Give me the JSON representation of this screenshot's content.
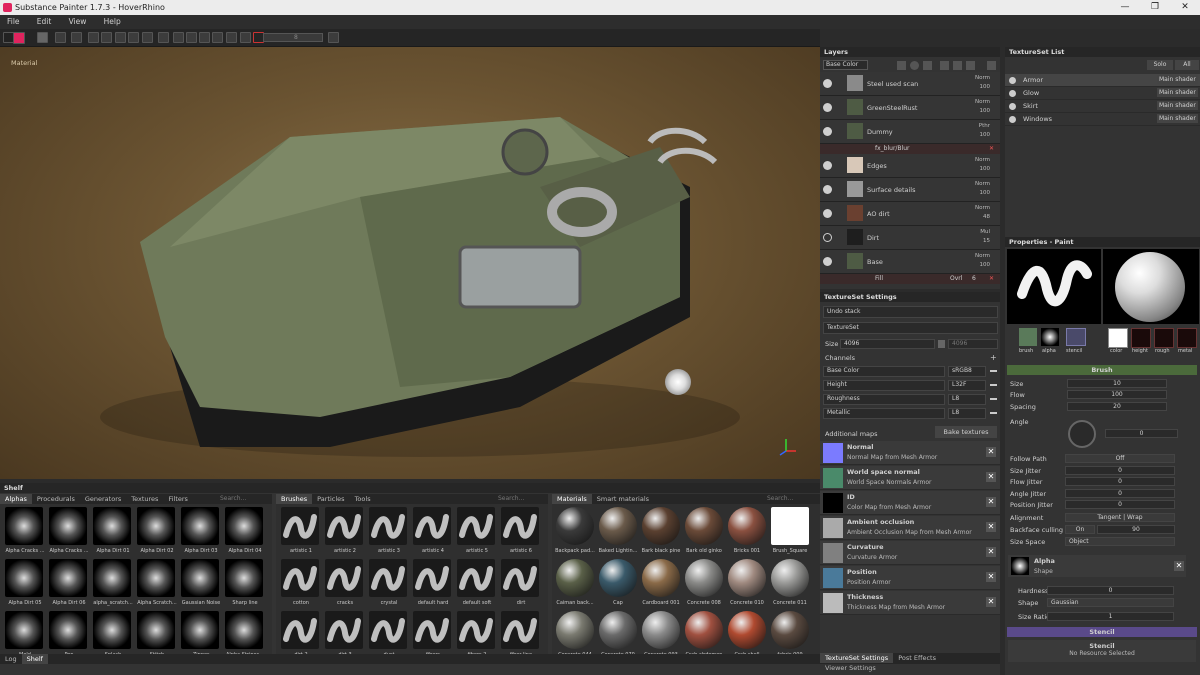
{
  "window": {
    "title": "Substance Painter 1.7.3 - HoverRhino",
    "minimize": "—",
    "maximize": "❐",
    "close": "✕"
  },
  "menu": [
    "File",
    "Edit",
    "View",
    "Help"
  ],
  "toolbar": {
    "size_value": "8"
  },
  "viewport": {
    "label": "Material"
  },
  "layers": {
    "title": "Layers",
    "channel": "Base Color",
    "rows": [
      {
        "name": "Steel used scan",
        "blend": "Norm",
        "opacity": "100",
        "color": "#8a8a8a",
        "visible": true
      },
      {
        "name": "GreenSteelRust",
        "blend": "Norm",
        "opacity": "100",
        "color": "#4e5b44",
        "visible": true
      },
      {
        "name": "Dummy",
        "blend": "Pthr",
        "opacity": "100",
        "color": "#4e5b44",
        "visible": true
      },
      {
        "name": "Edges",
        "blend": "Norm",
        "opacity": "100",
        "color": "#d8c8b8",
        "visible": true
      },
      {
        "name": "Surface details",
        "blend": "Norm",
        "opacity": "100",
        "color": "#999",
        "visible": true
      },
      {
        "name": "AO dirt",
        "blend": "Norm",
        "opacity": "48",
        "color": "#6a4030",
        "visible": true
      },
      {
        "name": "Dirt",
        "blend": "Mul",
        "opacity": "15",
        "color": "#1e1e1e",
        "visible": false
      },
      {
        "name": "Base",
        "blend": "Norm",
        "opacity": "100",
        "color": "#4e5b44",
        "visible": true
      }
    ],
    "effect_blur": "fx_blur/Blur",
    "effect_fill": "Fill",
    "fill_blend": "Ovrl",
    "fill_opacity": "6"
  },
  "textureset_list": {
    "title": "TextureSet List",
    "solo": "Solo",
    "all": "All",
    "items": [
      {
        "name": "Armor",
        "shader": "Main shader"
      },
      {
        "name": "Glow",
        "shader": "Main shader"
      },
      {
        "name": "Skirt",
        "shader": "Main shader"
      },
      {
        "name": "Windows",
        "shader": "Main shader"
      }
    ]
  },
  "textureset_settings": {
    "title": "TextureSet Settings",
    "undo_stack": "Undo stack",
    "textureset": "TextureSet",
    "size_label": "Size",
    "size_w": "4096",
    "size_h": "4096",
    "channels_label": "Channels",
    "channels": [
      {
        "name": "Base Color",
        "format": "sRGB8"
      },
      {
        "name": "Height",
        "format": "L32F"
      },
      {
        "name": "Roughness",
        "format": "L8"
      },
      {
        "name": "Metallic",
        "format": "L8"
      }
    ],
    "additional_maps": "Additional maps",
    "bake": "Bake textures",
    "maps": [
      {
        "title": "Normal",
        "sub": "Normal Map from Mesh Armor",
        "color": "#7b7bff"
      },
      {
        "title": "World space normal",
        "sub": "World Space Normals Armor",
        "color": "#4a8a6a"
      },
      {
        "title": "ID",
        "sub": "Color Map from Mesh Armor",
        "color": "#000000"
      },
      {
        "title": "Ambient occlusion",
        "sub": "Ambient Occlusion Map from Mesh Armor",
        "color": "#aaaaaa"
      },
      {
        "title": "Curvature",
        "sub": "Curvature Armor",
        "color": "#808080"
      },
      {
        "title": "Position",
        "sub": "Position Armor",
        "color": "#4a7a9a"
      },
      {
        "title": "Thickness",
        "sub": "Thickness Map from Mesh Armor",
        "color": "#bbbbbb"
      }
    ],
    "bottom_tabs": [
      "TextureSet Settings",
      "Post Effects",
      "Viewer Settings"
    ]
  },
  "properties": {
    "title": "Properties - Paint",
    "brush_tabs": [
      "brush",
      "alpha",
      "stencil"
    ],
    "mat_tabs": [
      "color",
      "height",
      "rough",
      "metal"
    ],
    "brush_section": "Brush",
    "size": {
      "label": "Size",
      "value": "10"
    },
    "flow": {
      "label": "Flow",
      "value": "100"
    },
    "spacing": {
      "label": "Spacing",
      "value": "20"
    },
    "angle": {
      "label": "Angle",
      "value": "0"
    },
    "follow_path": {
      "label": "Follow Path",
      "value": "Off"
    },
    "size_jitter": {
      "label": "Size Jitter",
      "value": "0"
    },
    "flow_jitter": {
      "label": "Flow Jitter",
      "value": "0"
    },
    "angle_jitter": {
      "label": "Angle Jitter",
      "value": "0"
    },
    "position_jitter": {
      "label": "Position Jitter",
      "value": "0"
    },
    "alignment": {
      "label": "Alignment",
      "value": "Tangent | Wrap"
    },
    "backface": {
      "label": "Backface culling",
      "on": "On",
      "value": "90"
    },
    "size_space": {
      "label": "Size Space",
      "value": "Object"
    },
    "alpha_section": "Alpha",
    "alpha_shape": "Shape",
    "hardness": {
      "label": "Hardness",
      "value": "0"
    },
    "shape": {
      "label": "Shape",
      "value": "Gaussian"
    },
    "size_ratio": {
      "label": "Size Ratio",
      "value": "1"
    },
    "stencil_section": "Stencil",
    "stencil_none": "No Resource Selected",
    "stencil_label": "Stencil"
  },
  "shelf": {
    "title": "Shelf",
    "alpha_tabs": [
      "Alphas",
      "Procedurals",
      "Generators",
      "Textures",
      "Filters"
    ],
    "search": "Search...",
    "alphas": [
      "Alpha Cracks ...",
      "Alpha Cracks ...",
      "Alpha Dirt 01",
      "Alpha Dirt 02",
      "Alpha Dirt 03",
      "Alpha Dirt 04",
      "Alpha Dirt 05",
      "Alpha Dirt 06",
      "alpha_scratch...",
      "Alpha Scratch...",
      "Gaussian Noise",
      "Sharp line",
      "Mold",
      "Pen",
      "Splash",
      "Stitch",
      "Zipper",
      "Alpha Stripes..."
    ],
    "brush_tabs": [
      "Brushes",
      "Particles",
      "Tools"
    ],
    "brushes": [
      "artistic 1",
      "artistic 2",
      "artistic 3",
      "artistic 4",
      "artistic 5",
      "artistic 6",
      "cotton",
      "cracks",
      "crystal",
      "default hard",
      "default soft",
      "dirt",
      "dirt 2",
      "dirt 3",
      "dust",
      "fibers",
      "fibers 2",
      "fiber line"
    ],
    "mat_tabs": [
      "Materials",
      "Smart materials"
    ],
    "materials": [
      {
        "n": "Backpack pad...",
        "c": "#3a3a3a"
      },
      {
        "n": "Baked Lightin...",
        "c": "#6a5a4a"
      },
      {
        "n": "Bark black pine",
        "c": "#5a4030"
      },
      {
        "n": "Bark old ginko",
        "c": "#6a4a38"
      },
      {
        "n": "Bricks 001",
        "c": "#8a5040"
      },
      {
        "n": "Brush_Square",
        "c": "#ffffff"
      },
      {
        "n": "Caiman back...",
        "c": "#5a6048"
      },
      {
        "n": "Cap",
        "c": "#3a5a6a"
      },
      {
        "n": "Cardboard 001",
        "c": "#8a6a48"
      },
      {
        "n": "Concrete 008",
        "c": "#8a8a88"
      },
      {
        "n": "Concrete 010",
        "c": "#a08a80"
      },
      {
        "n": "Concrete 011",
        "c": "#9a9a98"
      },
      {
        "n": "Concrete 044",
        "c": "#7a7a70"
      },
      {
        "n": "Concrete 070",
        "c": "#6a6a6a"
      },
      {
        "n": "Concrete 093",
        "c": "#8a8a8a"
      },
      {
        "n": "Crab abdomen",
        "c": "#a05040"
      },
      {
        "n": "Crab shell",
        "c": "#b04a30"
      },
      {
        "n": "fabric 009",
        "c": "#5a4a40"
      }
    ],
    "bottom_tabs": [
      "Log",
      "Shelf"
    ]
  }
}
